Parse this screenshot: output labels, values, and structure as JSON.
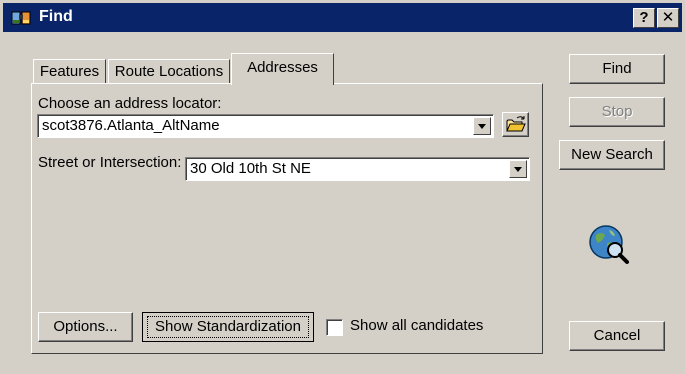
{
  "window": {
    "title": "Find",
    "icon": "find-binoculars-icon"
  },
  "titlebar_buttons": {
    "help": "?",
    "close": "✕"
  },
  "tabs": [
    {
      "label": "Features",
      "selected": false
    },
    {
      "label": "Route Locations",
      "selected": false
    },
    {
      "label": "Addresses",
      "selected": true
    }
  ],
  "address_locator": {
    "label": "Choose an address locator:",
    "value": "scot3876.Atlanta_AltName",
    "browse_icon": "open-folder-icon"
  },
  "street": {
    "label": "Street or Intersection:",
    "value": "30 Old 10th St NE"
  },
  "bottom": {
    "options_label": "Options...",
    "standardization_label": "Show Standardization",
    "show_all_label": "Show all candidates",
    "show_all_checked": false
  },
  "side_buttons": {
    "find": "Find",
    "stop": "Stop",
    "new_search": "New Search",
    "cancel": "Cancel"
  },
  "decor": {
    "globe_icon": "globe-magnifier-icon"
  }
}
